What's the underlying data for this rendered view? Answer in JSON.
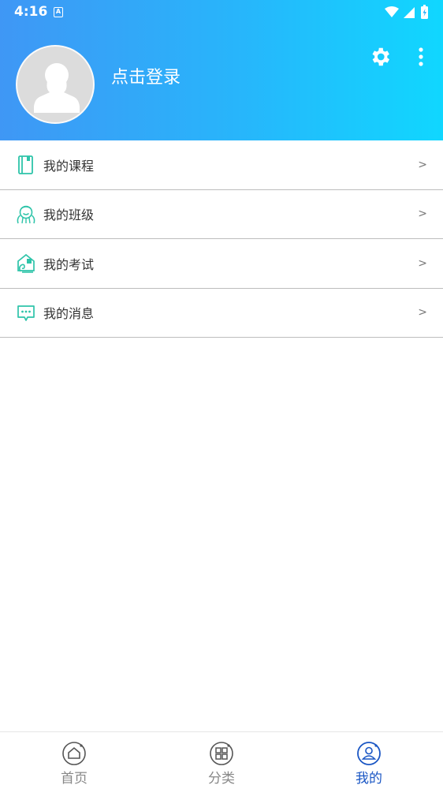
{
  "status": {
    "time": "4:16",
    "notif_letter": "A"
  },
  "header": {
    "login_text": "点击登录"
  },
  "menu": {
    "items": [
      {
        "label": "我的课程",
        "arrow": ">"
      },
      {
        "label": "我的班级",
        "arrow": ">"
      },
      {
        "label": "我的考试",
        "arrow": ">"
      },
      {
        "label": "我的消息",
        "arrow": ">"
      }
    ]
  },
  "tabbar": {
    "tabs": [
      {
        "label": "首页"
      },
      {
        "label": "分类"
      },
      {
        "label": "我的"
      }
    ]
  },
  "colors": {
    "header_start": "#3f97f5",
    "header_end": "#10d7ff",
    "icon_teal": "#2ec4a9",
    "tab_active": "#1a56c4",
    "tab_inactive": "#888888"
  },
  "icons": {
    "settings": "gear-icon",
    "more": "more-vertical-icon",
    "course": "book-icon",
    "class": "people-icon",
    "exam": "exam-house-icon",
    "message": "chat-icon",
    "home": "home-icon",
    "category": "category-grid-icon",
    "mine": "user-icon"
  }
}
